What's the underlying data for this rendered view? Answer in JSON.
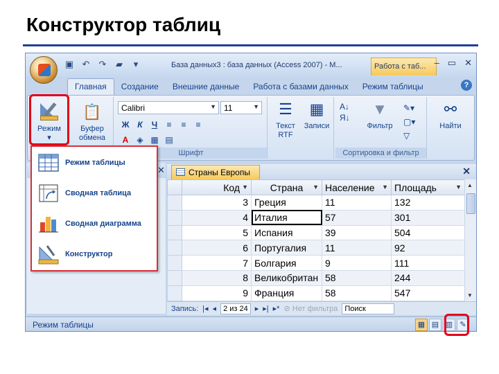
{
  "slide": {
    "title": "Конструктор таблиц"
  },
  "window": {
    "title": "База данных3 : база данных (Access 2007) - М...",
    "context_tab": "Работа с таб...",
    "qat_icons": [
      "save-icon",
      "undo-icon",
      "redo-icon",
      "open-folder-icon",
      "customize-icon"
    ]
  },
  "tabs": [
    "Главная",
    "Создание",
    "Внешние данные",
    "Работа с базами данных",
    "Режим таблицы"
  ],
  "ribbon": {
    "view_button": {
      "line1": "Режим",
      "arrow": "▾"
    },
    "clipboard_button": {
      "line1": "Буфер",
      "line2": "обмена"
    },
    "font_name": "Calibri",
    "font_size": "11",
    "bold": "Ж",
    "italic": "К",
    "underline": "Ч",
    "font_group_label": "Шрифт",
    "text_rtf": {
      "line1": "Текст",
      "line2": "RTF"
    },
    "records": "Записи",
    "filter": "Фильтр",
    "find": "Найти",
    "sort_filter_label": "Сортировка и фильтр"
  },
  "view_menu": [
    {
      "label": "Режим таблицы",
      "icon": "datasheet-icon"
    },
    {
      "label": "Сводная таблица",
      "icon": "pivot-table-icon"
    },
    {
      "label": "Сводная диаграмма",
      "icon": "pivot-chart-icon"
    },
    {
      "label": "Конструктор",
      "icon": "design-view-icon"
    }
  ],
  "document": {
    "tab_title": "Страны Европы",
    "columns": [
      "Код",
      "Страна",
      "Население",
      "Площадь"
    ],
    "rows": [
      {
        "code": "3",
        "country": "Греция",
        "population": "11",
        "area": "132"
      },
      {
        "code": "4",
        "country": "Италия",
        "population": "57",
        "area": "301"
      },
      {
        "code": "5",
        "country": "Испания",
        "population": "39",
        "area": "504"
      },
      {
        "code": "6",
        "country": "Португалия",
        "population": "11",
        "area": "92"
      },
      {
        "code": "7",
        "country": "Болгария",
        "population": "9",
        "area": "111"
      },
      {
        "code": "8",
        "country": "Великобритан",
        "population": "58",
        "area": "244"
      },
      {
        "code": "9",
        "country": "Франция",
        "population": "58",
        "area": "547"
      }
    ]
  },
  "navbar": {
    "label": "Запись:",
    "position": "2 из 24",
    "no_filter": "Нет фильтра",
    "search": "Поиск"
  },
  "status": {
    "text": "Режим таблицы"
  },
  "colors": {
    "highlight": "#e2001a",
    "ribbon": "#d4e2f3",
    "accent": "#f6c95b"
  }
}
